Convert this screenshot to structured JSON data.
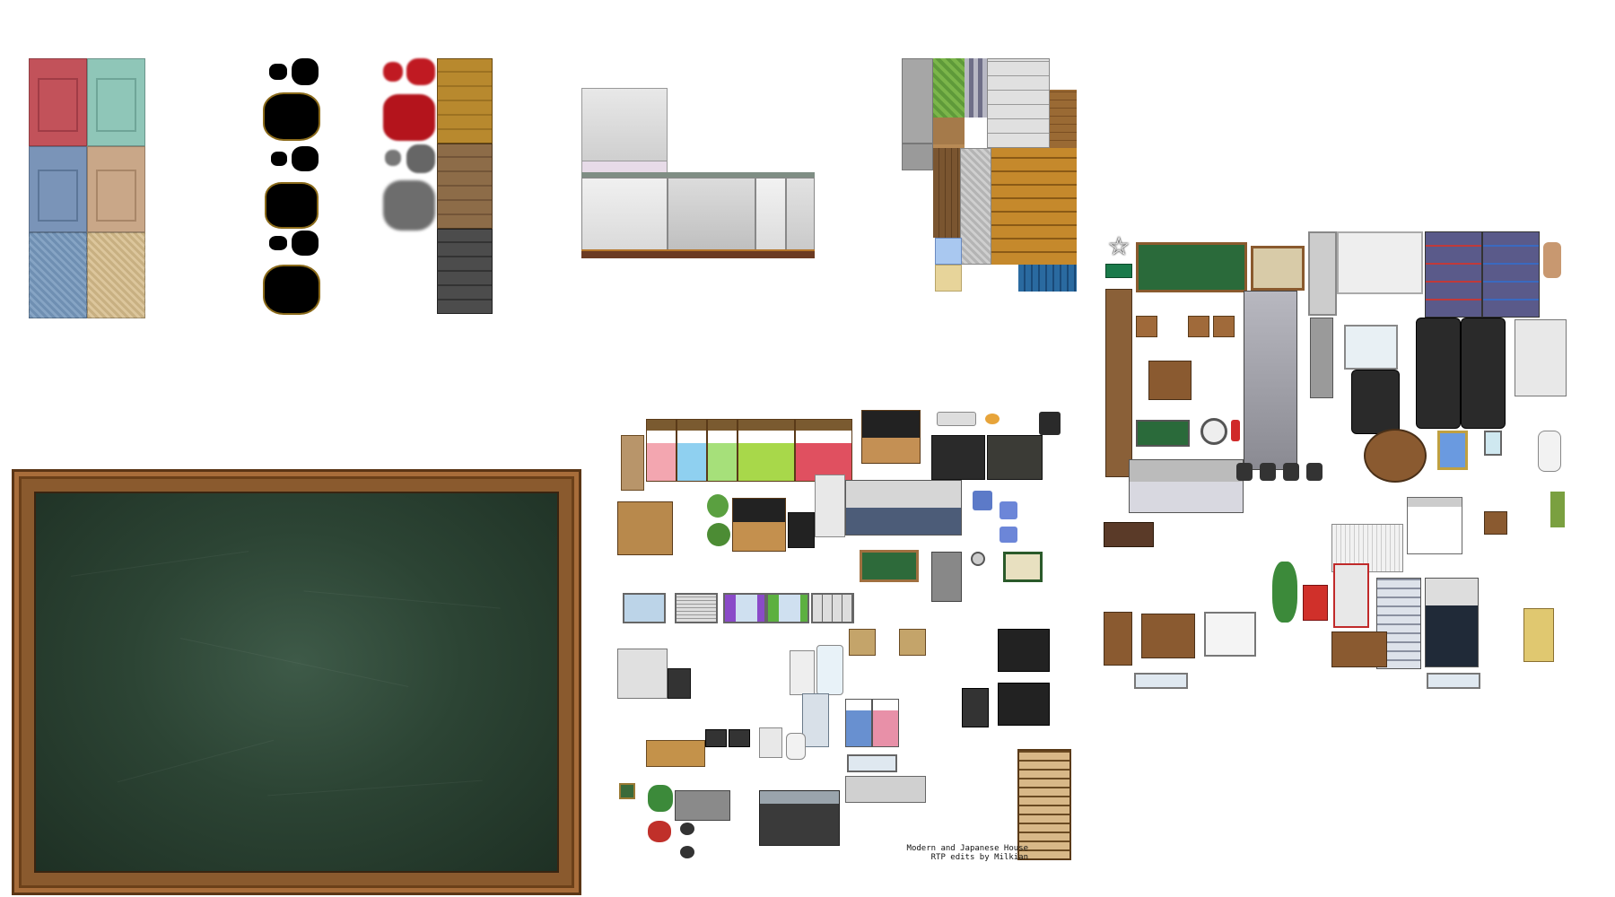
{
  "credit": {
    "line1": "Modern and Japanese House",
    "line2": "RTP edits by Milkian"
  },
  "colors": {
    "chalkboard_frame": "#8a5a2e",
    "chalkboard_surface": "#2c4434",
    "background": "#ffffff"
  },
  "tilesets": [
    {
      "name": "carpet-floor-tiles"
    },
    {
      "name": "shadow-autotiles"
    },
    {
      "name": "stain-and-wood-floor-tiles"
    },
    {
      "name": "wall-tiles"
    },
    {
      "name": "floor-and-ground-tiles"
    },
    {
      "name": "school-office-furniture-tileset"
    },
    {
      "name": "house-furniture-tileset"
    },
    {
      "name": "chalkboard-picture"
    }
  ]
}
